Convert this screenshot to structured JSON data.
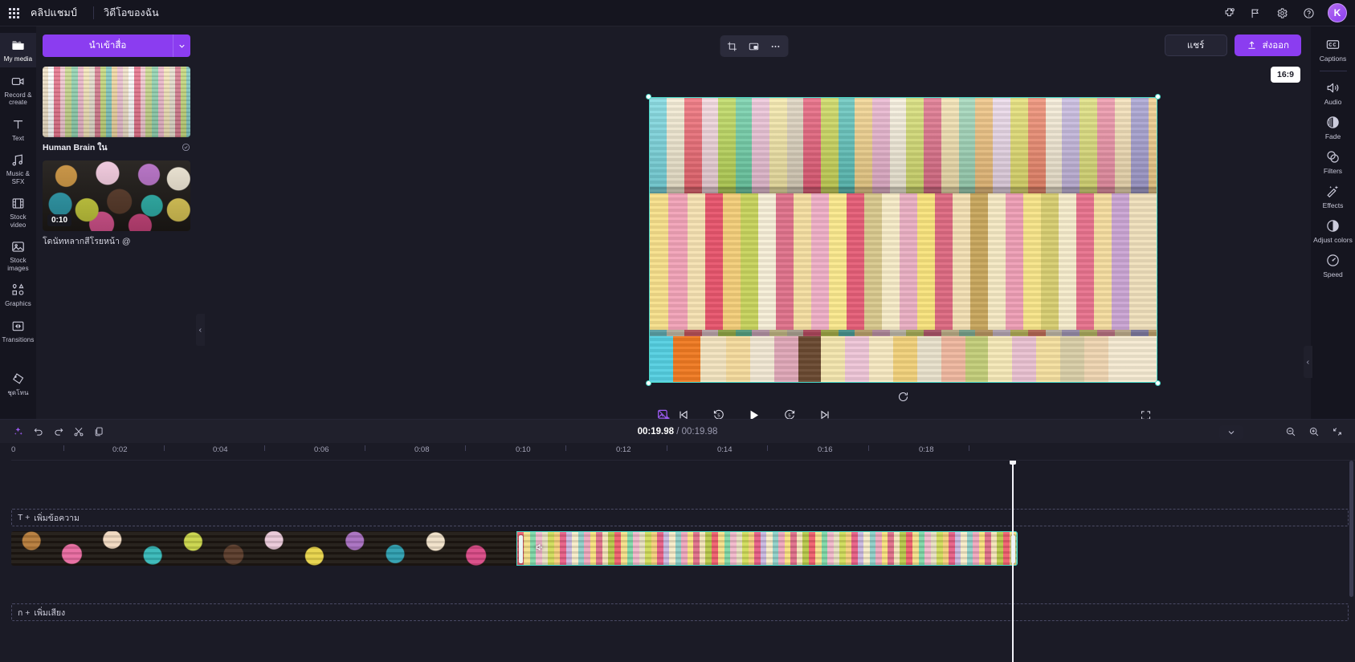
{
  "topbar": {
    "waffle_icon": "app-grid-icon",
    "brand": "คลิปแชมป์",
    "project_name": "วิดีโอของฉัน",
    "icons": [
      "plugin-icon",
      "flag-icon",
      "gear-icon",
      "help-icon"
    ],
    "avatar_initial": "K"
  },
  "left_rail": [
    {
      "label": "My media",
      "icon": "folder-icon",
      "active": true
    },
    {
      "label": "Record & create",
      "icon": "camera-icon",
      "active": false
    },
    {
      "label": "Text",
      "icon": "text-icon",
      "active": false
    },
    {
      "label": "Music & SFX",
      "icon": "music-icon",
      "active": false
    },
    {
      "label": "Stock video",
      "icon": "film-icon",
      "active": false
    },
    {
      "label": "Stock images",
      "icon": "image-icon",
      "active": false
    },
    {
      "label": "Graphics",
      "icon": "shapes-icon",
      "active": false
    },
    {
      "label": "Transitions",
      "icon": "transitions-icon",
      "active": false
    },
    {
      "label": "ชุดโทน",
      "icon": "brandkit-icon",
      "active": false
    }
  ],
  "media_panel": {
    "import_label": "นำเข้าสื่อ",
    "import_caret_icon": "chevron-down-icon",
    "collapse_icon": "chevron-left-icon",
    "items": [
      {
        "name": "Human Brain ใน",
        "duration": "",
        "thumb": "macaron",
        "badge_icon": "check-circle-icon"
      },
      {
        "name": "โดนัทหลากสีโรยหน้า @",
        "duration": "0:10",
        "thumb": "donut",
        "badge_icon": ""
      }
    ]
  },
  "preview": {
    "float_tools": [
      "crop-icon",
      "picture-in-picture-icon",
      "more-options-icon"
    ],
    "share_label": "แชร์",
    "export_label": "ส่งออก",
    "export_icon": "upload-icon",
    "aspect_ratio": "16:9",
    "transport": {
      "magic_icon": "magic-remove-bg-icon",
      "prev_icon": "skip-previous-icon",
      "back5_icon": "rewind-5-icon",
      "play_icon": "play-icon",
      "fwd5_icon": "forward-5-icon",
      "next_icon": "skip-next-icon",
      "fullscreen_icon": "fullscreen-icon"
    },
    "collapse_icon": "chevron-left-icon"
  },
  "right_rail": [
    {
      "label": "Captions",
      "icon": "captions-icon"
    },
    {
      "label": "Audio",
      "icon": "speaker-icon"
    },
    {
      "label": "Fade",
      "icon": "fade-icon"
    },
    {
      "label": "Filters",
      "icon": "filters-icon"
    },
    {
      "label": "Effects",
      "icon": "effects-icon"
    },
    {
      "label": "Adjust colors",
      "icon": "contrast-icon"
    },
    {
      "label": "Speed",
      "icon": "speed-icon"
    }
  ],
  "timeline": {
    "tools": [
      "magic-tools-icon",
      "undo-icon",
      "redo-icon",
      "split-icon",
      "duplicate-icon"
    ],
    "current_time": "00:19.98",
    "total_time": "00:19.98",
    "zoom_out_icon": "zoom-out-icon",
    "zoom_in_icon": "zoom-in-icon",
    "fit-icon": "fit-to-screen-icon",
    "collapse_chevron": "chevron-down-icon",
    "ruler_ticks": [
      "0",
      "0:02",
      "0:04",
      "0:06",
      "0:08",
      "0:10",
      "0:12",
      "0:14",
      "0:16",
      "0:18"
    ],
    "text_track_label": "เพิ่มข้อความ",
    "text_track_prefix": "T +",
    "audio_track_label": "เพิ่มเสียง",
    "audio_track_prefix": "ก +",
    "clips": [
      {
        "name": "donut-clip",
        "selected": false
      },
      {
        "name": "macaron-clip",
        "selected": true,
        "audio_icon": "speaker-icon"
      }
    ]
  },
  "colors": {
    "accent": "#8b3df0",
    "selection": "#49d9c8",
    "background": "#1b1b26",
    "panel": "#15151f"
  }
}
